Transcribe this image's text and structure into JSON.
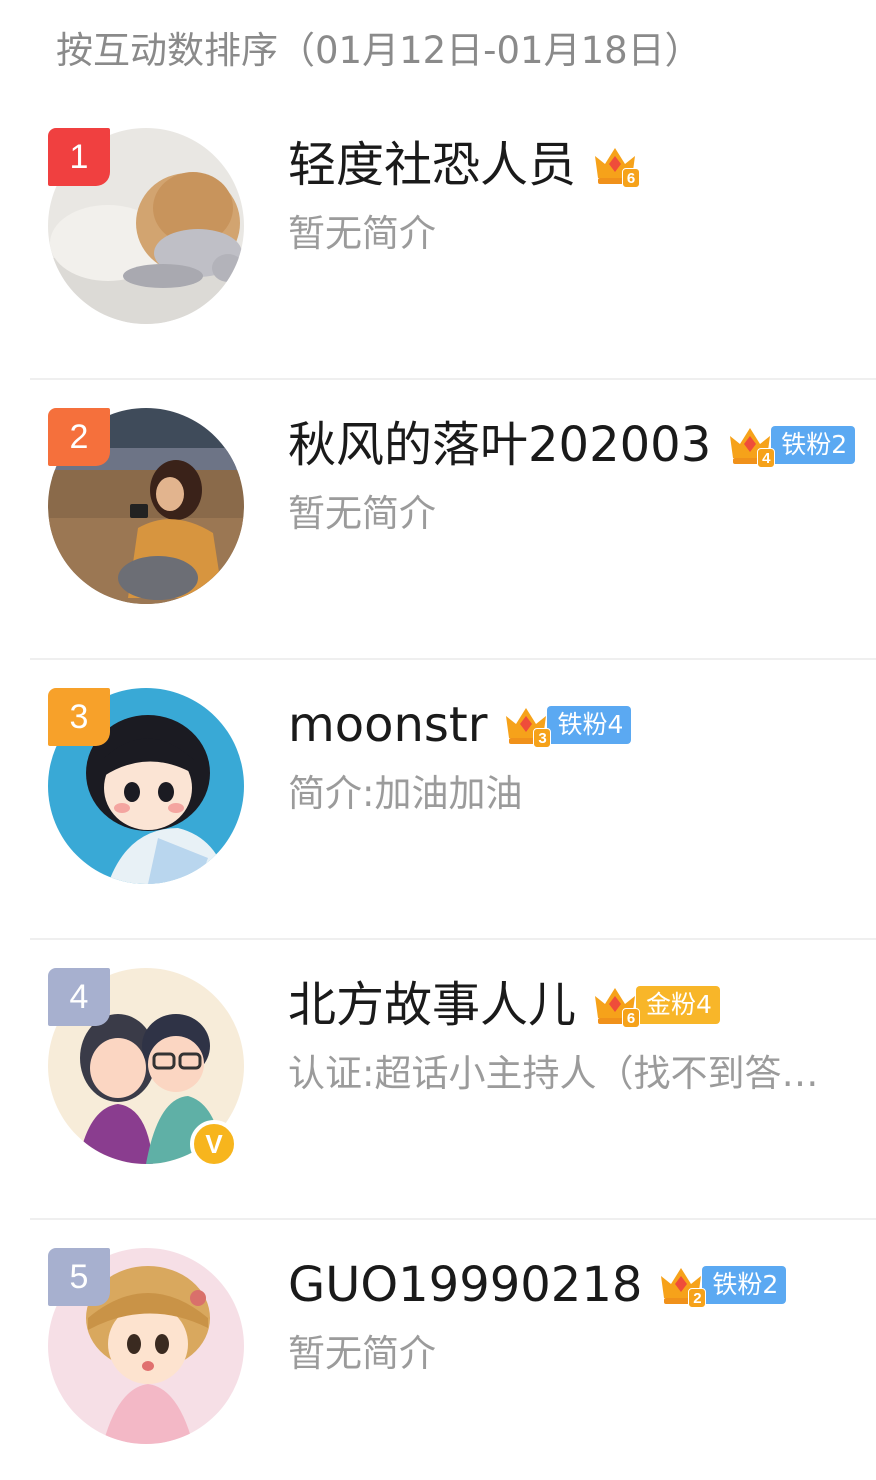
{
  "header": {
    "title": "按互动数排序（01月12日-01月18日）"
  },
  "colors": {
    "rank1": "#f04040",
    "rank2": "#f5703c",
    "rank3": "#f7a12a",
    "rank_other": "#a7b0cf",
    "iron_fan": "#5ba9f2",
    "gold_fan": "#f8b629",
    "crown": "#f6a21a"
  },
  "ranking": [
    {
      "rank": "1",
      "name": "轻度社恐人员",
      "crown_level": "6",
      "fan_badge": "",
      "intro": "暂无简介",
      "avatar_icon": "puppy-photo-avatar",
      "verified": false
    },
    {
      "rank": "2",
      "name": "秋风的落叶202003",
      "crown_level": "4",
      "fan_badge": "铁粉2",
      "intro": "暂无简介",
      "avatar_icon": "beach-girl-photo-avatar",
      "verified": false
    },
    {
      "rank": "3",
      "name": "moonstr",
      "crown_level": "3",
      "fan_badge": "铁粉4",
      "intro": "简介:加油加油",
      "avatar_icon": "cartoon-girl-avatar",
      "verified": false
    },
    {
      "rank": "4",
      "name": "北方故事人儿",
      "crown_level": "6",
      "fan_badge": "金粉4",
      "intro": "认证:超话小主持人（找不到答…",
      "avatar_icon": "cartoon-couple-avatar",
      "verified": true,
      "verified_mark": "V"
    },
    {
      "rank": "5",
      "name": "GUO19990218",
      "crown_level": "2",
      "fan_badge": "铁粉2",
      "intro": "暂无简介",
      "avatar_icon": "cartoon-baby-avatar",
      "verified": false
    }
  ]
}
